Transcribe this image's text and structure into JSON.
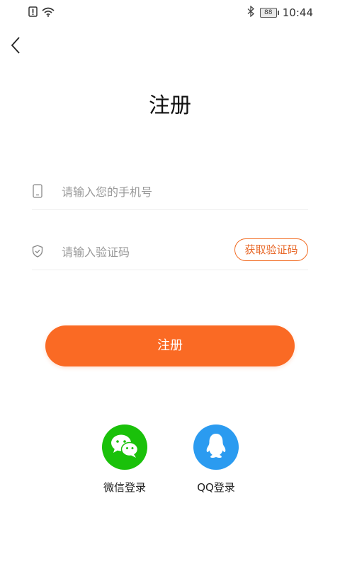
{
  "status_bar": {
    "time": "10:44",
    "battery": "88",
    "icons": [
      "alert-icon",
      "wifi-icon",
      "bluetooth-icon",
      "battery-icon"
    ]
  },
  "header": {
    "back_icon": "chevron-left-icon",
    "title": "注册"
  },
  "form": {
    "phone_placeholder": "请输入您的手机号",
    "phone_value": "",
    "code_placeholder": "请输入验证码",
    "code_value": "",
    "get_code_label": "获取验证码"
  },
  "register_button": {
    "label": "注册"
  },
  "social_login": {
    "wechat_label": "微信登录",
    "qq_label": "QQ登录"
  },
  "colors": {
    "accent": "#fa6a24",
    "wechat": "#1ac10a",
    "qq": "#2b9bf0",
    "placeholder": "#999999"
  }
}
